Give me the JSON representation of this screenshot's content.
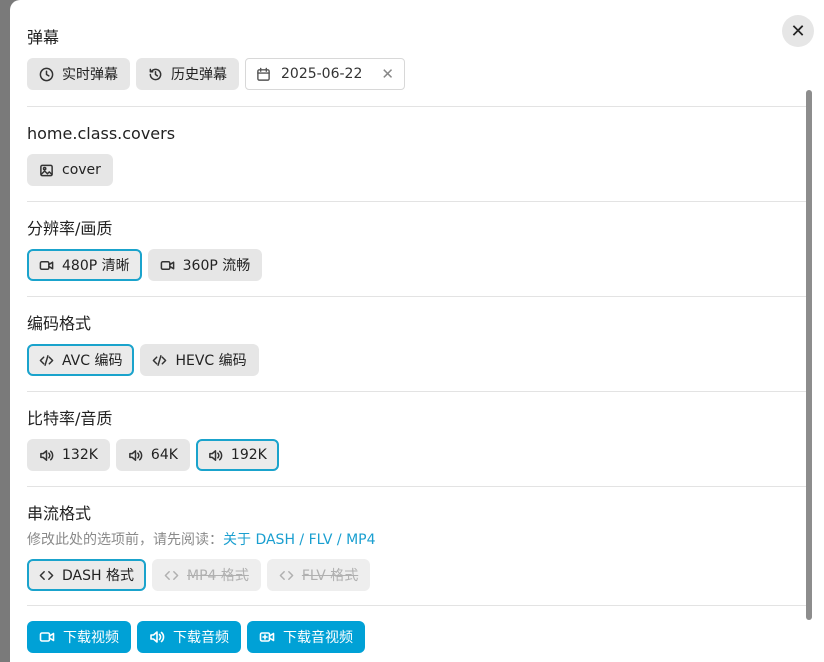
{
  "danmaku": {
    "heading": "弹幕",
    "realtime_label": "实时弹幕",
    "history_label": "历史弹幕",
    "date_value": "2025-06-22"
  },
  "covers": {
    "heading": "home.class.covers",
    "cover_label": "cover"
  },
  "resolution": {
    "heading": "分辨率/画质",
    "options": [
      {
        "label": "480P 清晰",
        "selected": true
      },
      {
        "label": "360P 流畅",
        "selected": false
      }
    ]
  },
  "codec": {
    "heading": "编码格式",
    "options": [
      {
        "label": "AVC 编码",
        "selected": true
      },
      {
        "label": "HEVC 编码",
        "selected": false
      }
    ]
  },
  "bitrate": {
    "heading": "比特率/音质",
    "options": [
      {
        "label": "132K",
        "selected": false
      },
      {
        "label": "64K",
        "selected": false
      },
      {
        "label": "192K",
        "selected": true
      }
    ]
  },
  "stream": {
    "heading": "串流格式",
    "note": "修改此处的选项前，请先阅读：",
    "note_link": "关于 DASH / FLV / MP4",
    "options": [
      {
        "label": "DASH 格式",
        "selected": true,
        "disabled": false
      },
      {
        "label": "MP4 格式",
        "selected": false,
        "disabled": true
      },
      {
        "label": "FLV 格式",
        "selected": false,
        "disabled": true
      }
    ]
  },
  "actions": {
    "download_video": "下载视频",
    "download_audio": "下载音频",
    "download_av": "下载音视频"
  },
  "close": {
    "glyph": "✕"
  },
  "colors": {
    "accent": "#00a1d6",
    "selected_border": "#1aa3cc",
    "chip_bg": "#e6e6e6"
  }
}
